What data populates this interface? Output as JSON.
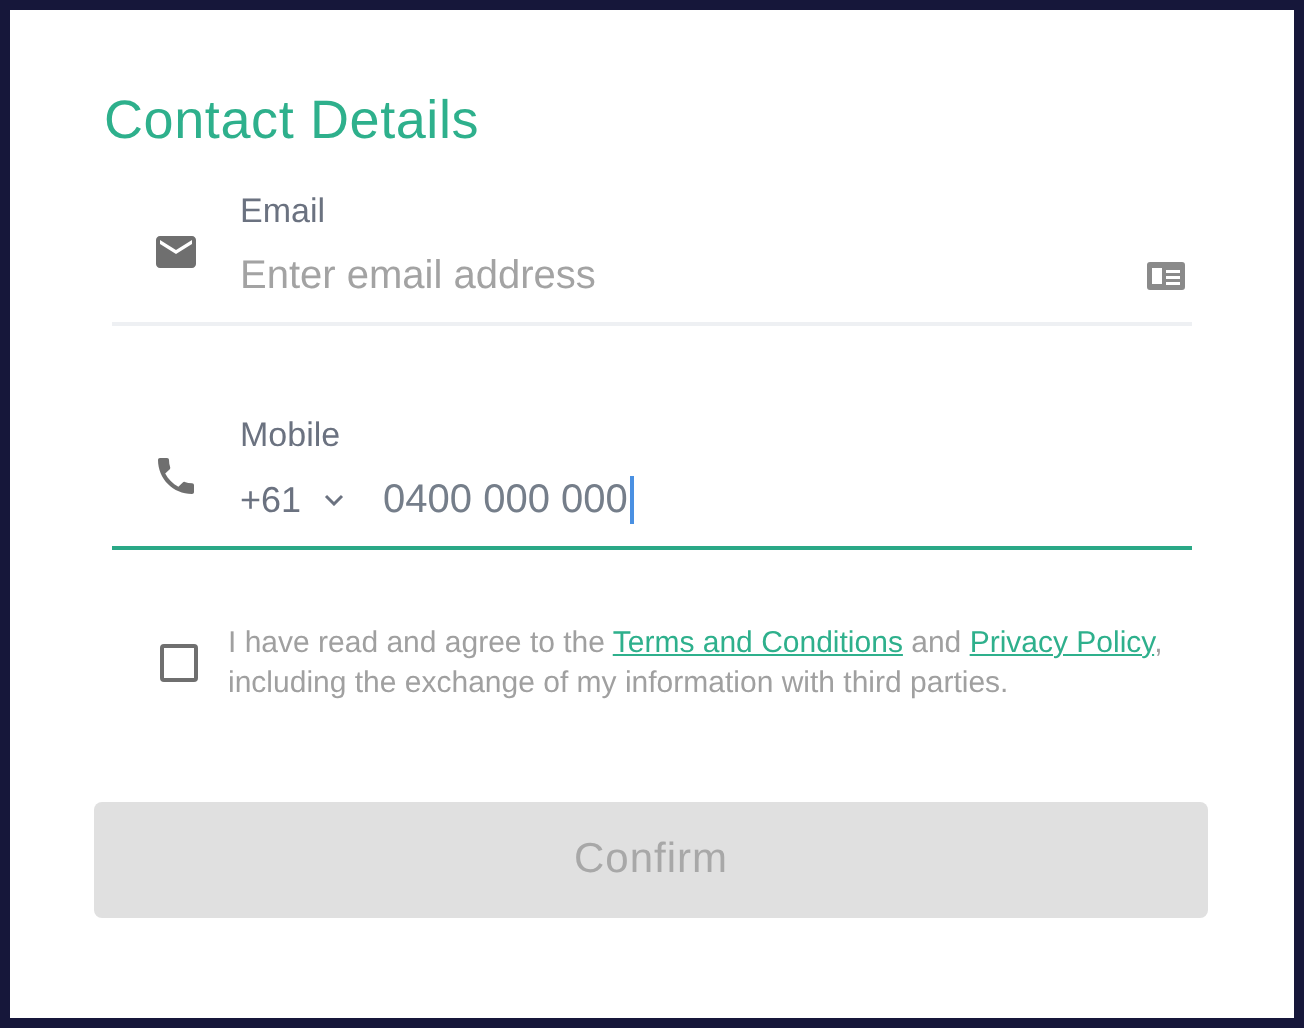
{
  "title": "Contact Details",
  "fields": [
    {
      "kind": "email",
      "label": "Email",
      "placeholder": "Enter email address",
      "focused": false
    },
    {
      "kind": "mobile",
      "label": "Mobile",
      "country_code": "+61",
      "value": "0400 000 000",
      "focused": true
    }
  ],
  "agreement": {
    "checked": false,
    "parts": [
      {
        "kind": "text",
        "text": "I have read and agree to the "
      },
      {
        "kind": "link",
        "text": "Terms and Conditions"
      },
      {
        "kind": "text",
        "text": " and "
      },
      {
        "kind": "link",
        "text": "Privacy Policy"
      },
      {
        "kind": "text",
        "text": ", including the exchange of my information with third parties."
      }
    ]
  },
  "confirm": {
    "label": "Confirm",
    "disabled": true
  }
}
